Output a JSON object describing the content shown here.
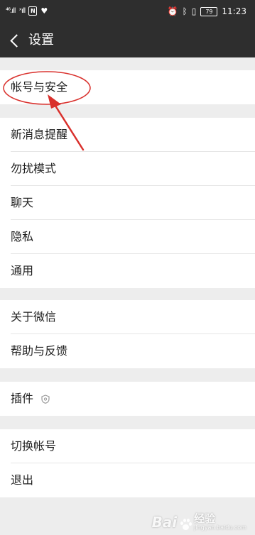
{
  "status_bar": {
    "signal_1": "⁴⁶.ıll",
    "signal_2": "ˣıll",
    "nfc": "N",
    "battery_level": "79",
    "time": "11:23"
  },
  "header": {
    "title": "设置"
  },
  "groups": [
    {
      "items": [
        {
          "label": "帐号与安全"
        }
      ]
    },
    {
      "items": [
        {
          "label": "新消息提醒"
        },
        {
          "label": "勿扰模式"
        },
        {
          "label": "聊天"
        },
        {
          "label": "隐私"
        },
        {
          "label": "通用"
        }
      ]
    },
    {
      "items": [
        {
          "label": "关于微信"
        },
        {
          "label": "帮助与反馈"
        }
      ]
    },
    {
      "items": [
        {
          "label": "插件"
        }
      ]
    },
    {
      "items": [
        {
          "label": "切换帐号"
        },
        {
          "label": "退出"
        }
      ]
    }
  ],
  "watermark": {
    "brand": "Bai",
    "word": "经验",
    "url": "jingyan.baidu.com"
  },
  "colors": {
    "bar": "#2e2e2e",
    "background": "#ededed",
    "annotation": "#d9302c"
  }
}
